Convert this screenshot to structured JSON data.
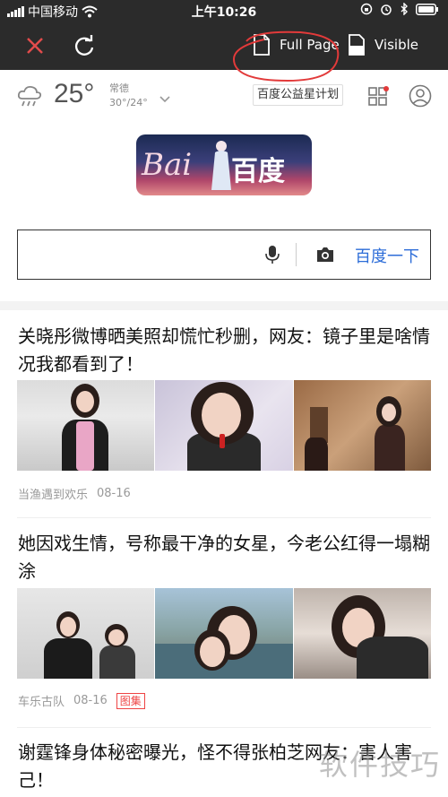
{
  "status_bar": {
    "carrier": "中国移动",
    "time": "上午10:26"
  },
  "toolbar": {
    "full_page_label": "Full Page",
    "visible_label": "Visible"
  },
  "weather": {
    "temperature": "25°",
    "city": "常德",
    "range": "30°/24°"
  },
  "header": {
    "gongyi_label": "百度公益星计划"
  },
  "logo": {
    "latin": "Bai",
    "chinese": "百度"
  },
  "search": {
    "button_label": "百度一下",
    "value": ""
  },
  "feed": [
    {
      "title": "关晓彤微博晒美照却慌忙秒删，网友：镜子里是啥情况我都看到了！",
      "source": "当渔遇到欢乐",
      "date": "08-16",
      "tag": ""
    },
    {
      "title": "她因戏生情，号称最干净的女星，今老公红得一塌糊涂",
      "source": "车乐古队",
      "date": "08-16",
      "tag": "图集"
    },
    {
      "title": "谢霆锋身体秘密曝光，怪不得张柏芝网友：害人害己！"
    }
  ],
  "watermark": "软件技巧",
  "colors": {
    "toolbar_bg": "#2b2b2b",
    "accent_blue": "#2d6dd8",
    "tag_red": "#e44444",
    "close_red": "#e24b4b"
  }
}
